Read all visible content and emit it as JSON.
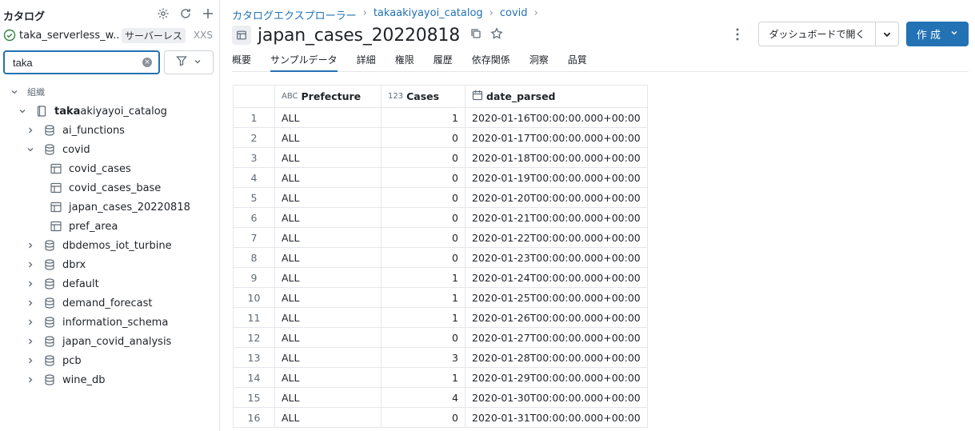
{
  "sidebar": {
    "title": "カタログ",
    "warehouse": {
      "name": "taka_serverless_w...",
      "badge": "サーバーレス",
      "size": "XXS"
    },
    "search": {
      "value": "taka",
      "placeholder": ""
    },
    "section_label": "組織",
    "catalog": {
      "highlight": "taka",
      "rest": "akiyayoi_catalog"
    },
    "schemas": [
      {
        "label": "ai_functions"
      },
      {
        "label": "covid"
      },
      {
        "label": "dbdemos_iot_turbine"
      },
      {
        "label": "dbrx"
      },
      {
        "label": "default"
      },
      {
        "label": "demand_forecast"
      },
      {
        "label": "information_schema"
      },
      {
        "label": "japan_covid_analysis"
      },
      {
        "label": "pcb"
      },
      {
        "label": "wine_db"
      }
    ],
    "covid_tables": [
      {
        "label": "covid_cases"
      },
      {
        "label": "covid_cases_base"
      },
      {
        "label": "japan_cases_20220818"
      },
      {
        "label": "pref_area"
      }
    ]
  },
  "breadcrumb": [
    "カタログエクスプローラー",
    "takaakiyayoi_catalog",
    "covid"
  ],
  "page_title": "japan_cases_20220818",
  "actions": {
    "dashboard": "ダッシュボードで開く",
    "create": "作 成"
  },
  "tabs": [
    "概要",
    "サンプルデータ",
    "詳細",
    "権限",
    "履歴",
    "依存関係",
    "洞察",
    "品質"
  ],
  "table": {
    "type_icons": {
      "string": "ABC",
      "number": "123"
    },
    "columns": [
      "Prefecture",
      "Cases",
      "date_parsed"
    ],
    "rows": [
      [
        "1",
        "ALL",
        "1",
        "2020-01-16T00:00:00.000+00:00"
      ],
      [
        "2",
        "ALL",
        "0",
        "2020-01-17T00:00:00.000+00:00"
      ],
      [
        "3",
        "ALL",
        "0",
        "2020-01-18T00:00:00.000+00:00"
      ],
      [
        "4",
        "ALL",
        "0",
        "2020-01-19T00:00:00.000+00:00"
      ],
      [
        "5",
        "ALL",
        "0",
        "2020-01-20T00:00:00.000+00:00"
      ],
      [
        "6",
        "ALL",
        "0",
        "2020-01-21T00:00:00.000+00:00"
      ],
      [
        "7",
        "ALL",
        "0",
        "2020-01-22T00:00:00.000+00:00"
      ],
      [
        "8",
        "ALL",
        "0",
        "2020-01-23T00:00:00.000+00:00"
      ],
      [
        "9",
        "ALL",
        "1",
        "2020-01-24T00:00:00.000+00:00"
      ],
      [
        "10",
        "ALL",
        "1",
        "2020-01-25T00:00:00.000+00:00"
      ],
      [
        "11",
        "ALL",
        "1",
        "2020-01-26T00:00:00.000+00:00"
      ],
      [
        "12",
        "ALL",
        "0",
        "2020-01-27T00:00:00.000+00:00"
      ],
      [
        "13",
        "ALL",
        "3",
        "2020-01-28T00:00:00.000+00:00"
      ],
      [
        "14",
        "ALL",
        "1",
        "2020-01-29T00:00:00.000+00:00"
      ],
      [
        "15",
        "ALL",
        "4",
        "2020-01-30T00:00:00.000+00:00"
      ],
      [
        "16",
        "ALL",
        "0",
        "2020-01-31T00:00:00.000+00:00"
      ]
    ]
  },
  "colors": {
    "accent": "#2272b4",
    "success": "#2e8540"
  }
}
